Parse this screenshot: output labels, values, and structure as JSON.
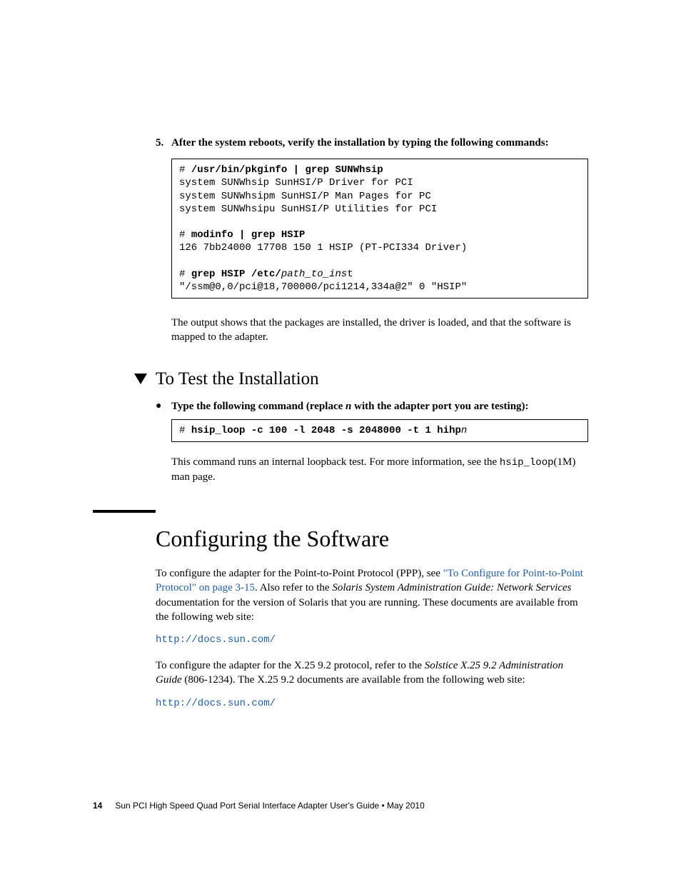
{
  "step5": {
    "num": "5.",
    "text": "After the system reboots, verify the installation by typing the following commands:"
  },
  "code1": {
    "l1a": "# ",
    "l1b": "/usr/bin/pkginfo | grep SUNWhsip",
    "l2": "system SUNWhsip SunHSI/P Driver for PCI",
    "l3": "system SUNWhsipm SunHSI/P Man Pages for PC",
    "l4": "system SUNWhsipu SunHSI/P Utilities for PCI",
    "l5a": "# ",
    "l5b": "modinfo | grep HSIP",
    "l6": "126 7bb24000 17708 150 1 HSIP (PT-PCI334 Driver)",
    "l7a": "# ",
    "l7b": "grep HSIP /etc/",
    "l7c": "path_to_ins",
    "l7d": "t",
    "l8": "\"/ssm@0,0/pci@18,700000/pci1214,334a@2\" 0 \"HSIP\""
  },
  "afterCode1": "The output shows that the packages are installed, the driver is loaded, and that the software is mapped to the adapter.",
  "h2": "To Test the Installation",
  "bullet": {
    "t1": "Type the following command (replace ",
    "n": "n",
    "t2": " with the adapter port you are testing):"
  },
  "code2": {
    "l1a": "# ",
    "l1b": "hsip_loop -c 100 -l 2048 -s 2048000 -t 1 hihp",
    "l1c": "n"
  },
  "afterCode2": {
    "t1": "This command runs an internal loopback test. For more information, see the ",
    "mono": "hsip_loop",
    "t2": "(1M) man page."
  },
  "h1": "Configuring the Software",
  "p1": {
    "t1": "To configure the adapter for the Point-to-Point Protocol (PPP), see ",
    "link": "\"To Configure for Point-to-Point Protocol\" on page 3-15",
    "t2": ". Also refer to the ",
    "book": "Solaris System Administration Guide: Network Services",
    "t3": " documentation for the version of Solaris that you are running. These documents are available from the following web site:"
  },
  "url1": "http://docs.sun.com/",
  "p2": {
    "t1": "To configure the adapter for the X.25 9.2 protocol, refer to the ",
    "book": "Solstice X.25 9.2 Administration Guide",
    "t2": " (806-1234). The X.25 9.2 documents are available from the following web site:"
  },
  "url2": "http://docs.sun.com/",
  "footer": {
    "page": "14",
    "text": "Sun PCI High Speed Quad Port Serial Interface Adapter User's Guide  •  May 2010"
  }
}
